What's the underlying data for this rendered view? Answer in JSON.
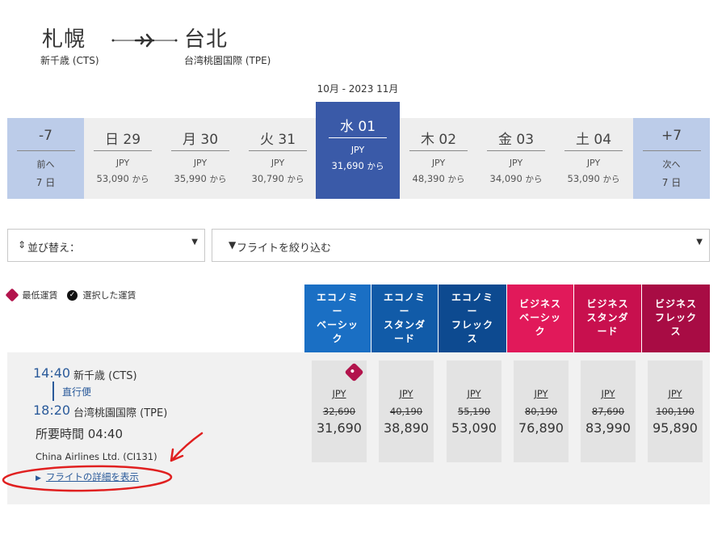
{
  "route": {
    "from_city": "札幌",
    "from_airport": "新千歳 (CTS)",
    "to_city": "台北",
    "to_airport": "台湾桃園国際 (TPE)"
  },
  "month_label": "10月 - 2023 11月",
  "dates": {
    "prev": {
      "label": "-7",
      "sub1": "前へ",
      "sub2": "7 日"
    },
    "next": {
      "label": "+7",
      "sub1": "次へ",
      "sub2": "7 日"
    },
    "days": [
      {
        "day": "日 29",
        "currency": "JPY",
        "price": "53,090",
        "suffix": "から"
      },
      {
        "day": "月 30",
        "currency": "JPY",
        "price": "35,990",
        "suffix": "から"
      },
      {
        "day": "火 31",
        "currency": "JPY",
        "price": "30,790",
        "suffix": "から"
      },
      {
        "day": "水 01",
        "currency": "JPY",
        "price": "31,690",
        "suffix": "から"
      },
      {
        "day": "木 02",
        "currency": "JPY",
        "price": "48,390",
        "suffix": "から"
      },
      {
        "day": "金 03",
        "currency": "JPY",
        "price": "34,090",
        "suffix": "から"
      },
      {
        "day": "土 04",
        "currency": "JPY",
        "price": "53,090",
        "suffix": "から"
      }
    ]
  },
  "controls": {
    "sort_icon": "sort-updown-icon",
    "sort_label": "並び替え：",
    "filter_icon": "funnel-icon",
    "filter_label": "フライトを絞り込む"
  },
  "legend": {
    "lowest": "最低運賃",
    "selected": "選択した運賃"
  },
  "fare_headers": [
    "エコノミー\nーベーシック",
    "エコノミー\nースタンダード",
    "エコノミー\nーフレックス",
    "ビジネスベーシック",
    "ビジネススタンダード",
    "ビジネスフレックス"
  ],
  "fare_header_lines": [
    [
      "エコノミ",
      "ー",
      "ベーシッ",
      "ク"
    ],
    [
      "エコノミ",
      "ー",
      "スタンダ",
      "ード"
    ],
    [
      "エコノミ",
      "ー",
      "フレック",
      "ス"
    ],
    [
      "ビジネス",
      "ベーシッ",
      "ク"
    ],
    [
      "ビジネス",
      "スタンダ",
      "ード"
    ],
    [
      "ビジネス",
      "フレック",
      "ス"
    ]
  ],
  "colors": {
    "economy": [
      "#1a6fc4",
      "#115ba8",
      "#0d4a90"
    ],
    "business": [
      "#e1195a",
      "#c8104e",
      "#a80c44"
    ],
    "selected_date": "#3a5aa8",
    "nav_date": "#bccce9"
  },
  "flight": {
    "dep_time": "14:40",
    "dep_airport": "新千歳 (CTS)",
    "nonstop": "直行便",
    "arr_time": "18:20",
    "arr_airport": "台湾桃園国際 (TPE)",
    "duration": "所要時間 04:40",
    "airline": "China Airlines Ltd. (CI131)",
    "details_link": "フライトの詳細を表示",
    "fares": [
      {
        "currency": "JPY",
        "original": "32,690",
        "price": "31,690",
        "lowest": true
      },
      {
        "currency": "JPY",
        "original": "40,190",
        "price": "38,890",
        "lowest": false
      },
      {
        "currency": "JPY",
        "original": "55,190",
        "price": "53,090",
        "lowest": false
      },
      {
        "currency": "JPY",
        "original": "80,190",
        "price": "76,890",
        "lowest": false
      },
      {
        "currency": "JPY",
        "original": "87,690",
        "price": "83,990",
        "lowest": false
      },
      {
        "currency": "JPY",
        "original": "100,190",
        "price": "95,890",
        "lowest": false
      }
    ]
  }
}
